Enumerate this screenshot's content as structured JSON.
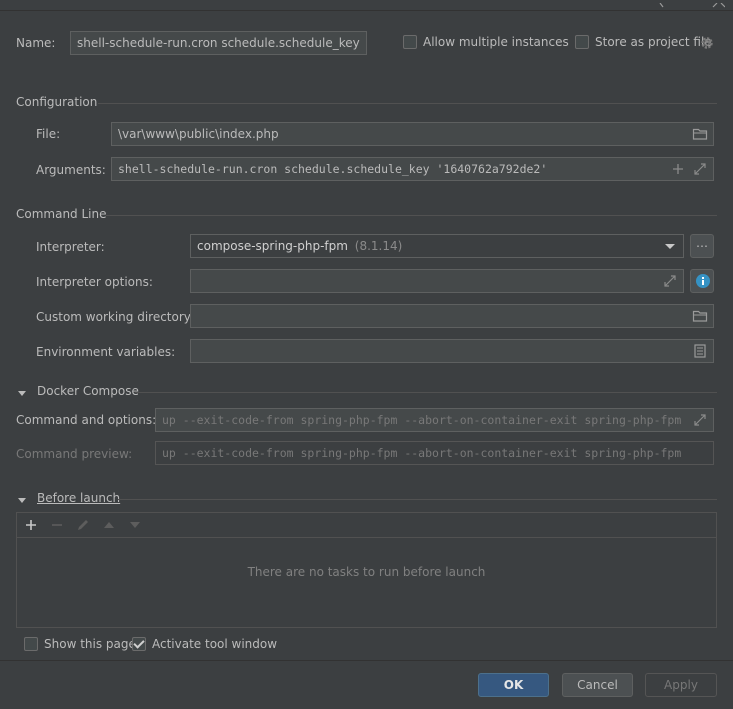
{
  "name": {
    "label": "Name:",
    "value": "shell-schedule-run.cron schedule.schedule_key",
    "allow_multiple_label": "Allow multiple instances",
    "allow_multiple_checked": false,
    "store_as_project_label": "Store as project file",
    "store_as_project_checked": false
  },
  "configuration": {
    "title": "Configuration",
    "file_label": "File:",
    "file_value": "\\var\\www\\public\\index.php",
    "arguments_label": "Arguments:",
    "arguments_value": "shell-schedule-run.cron schedule.schedule_key '1640762a792de2'"
  },
  "command_line": {
    "title": "Command Line",
    "interpreter_label": "Interpreter:",
    "interpreter_value": "compose-spring-php-fpm",
    "interpreter_version": "(8.1.14)",
    "interpreter_options_label": "Interpreter options:",
    "interpreter_options_value": "",
    "working_dir_label": "Custom working directory:",
    "working_dir_value": "",
    "env_vars_label": "Environment variables:",
    "env_vars_value": ""
  },
  "docker_compose": {
    "title": "Docker Compose",
    "command_options_label": "Command and options:",
    "command_options_placeholder": "up --exit-code-from spring-php-fpm --abort-on-container-exit spring-php-fpm",
    "command_preview_label": "Command preview:",
    "command_preview_value": "up --exit-code-from spring-php-fpm --abort-on-container-exit spring-php-fpm"
  },
  "before_launch": {
    "title": "Before launch",
    "empty_text": "There are no tasks to run before launch"
  },
  "footer": {
    "show_page_label": "Show this page",
    "show_page_checked": false,
    "activate_tool_label": "Activate tool window",
    "activate_tool_checked": true,
    "ok_label": "OK",
    "cancel_label": "Cancel",
    "apply_label": "Apply"
  },
  "colors": {
    "background": "#3c3f41",
    "field_background": "#45494a",
    "primary_button": "#365880",
    "info_icon": "#3592c4"
  }
}
